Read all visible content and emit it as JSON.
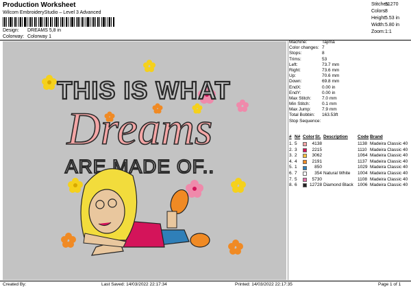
{
  "header": {
    "title": "Production Worksheet",
    "software": "Wilcom EmbroideryStudio – Level 3 Advanced",
    "design_label": "Design:",
    "design_value": "DREAMS 5,8 in",
    "colorway_label": "Colorway:",
    "colorway_value": "Colorway 1"
  },
  "stats": [
    {
      "label": "Stitches:",
      "value": "31270"
    },
    {
      "label": "Colors:",
      "value": "8"
    },
    {
      "label": "Height:",
      "value": "5.53 in"
    },
    {
      "label": "Width:",
      "value": "5.80 in"
    },
    {
      "label": "Zoom:",
      "value": "1:1"
    }
  ],
  "artwork": {
    "line1": "THIS IS WHAT",
    "line2": "Dreams",
    "line3": "ARE MADE OF..",
    "background": "#c3c3c3"
  },
  "machine_info": [
    {
      "label": "Machine:",
      "value": "Tajima"
    },
    {
      "label": "Color changes:",
      "value": "7"
    },
    {
      "label": "Stops:",
      "value": "8"
    },
    {
      "label": "Trims:",
      "value": "53"
    },
    {
      "label": "Left:",
      "value": "73.7 mm"
    },
    {
      "label": "Right:",
      "value": "73.6 mm"
    },
    {
      "label": "Up:",
      "value": "70.6 mm"
    },
    {
      "label": "Down:",
      "value": "69.8 mm"
    },
    {
      "label": "EndX:",
      "value": "0.00 in"
    },
    {
      "label": "EndY:",
      "value": "0.00 in"
    },
    {
      "label": "Max Stitch:",
      "value": "7.0 mm"
    },
    {
      "label": "Min Stitch:",
      "value": "0.1 mm"
    },
    {
      "label": "Max Jump:",
      "value": "7.9 mm"
    },
    {
      "label": "Total Bobbin:",
      "value": "163.53ft"
    }
  ],
  "stop_sequence": {
    "title": "Stop Sequence:",
    "headers": {
      "n": "#",
      "n2": "N#",
      "color": "Color",
      "st": "St.",
      "description": "Description",
      "code": "Code",
      "brand": "Brand"
    },
    "rows": [
      {
        "n": "1.",
        "n2": "5",
        "color": "#f4a6a6",
        "st": "4138",
        "description": "",
        "code": "1138",
        "brand": "Madeira Classic 40"
      },
      {
        "n": "2.",
        "n2": "3",
        "color": "#d4145a",
        "st": "2215",
        "description": "",
        "code": "1110",
        "brand": "Madeira Classic 40"
      },
      {
        "n": "3.",
        "n2": "2",
        "color": "#f5c242",
        "st": "3062",
        "description": "",
        "code": "1064",
        "brand": "Madeira Classic 40"
      },
      {
        "n": "4.",
        "n2": "4",
        "color": "#f08a24",
        "st": "2191",
        "description": "",
        "code": "1137",
        "brand": "Madeira Classic 40"
      },
      {
        "n": "5.",
        "n2": "1",
        "color": "#2f7fb8",
        "st": "850",
        "description": "",
        "code": "1029",
        "brand": "Madeira Classic 40"
      },
      {
        "n": "6.",
        "n2": "7",
        "color": "#ffffff",
        "st": "354",
        "description": "Natural White",
        "code": "1004",
        "brand": "Madeira Classic 40"
      },
      {
        "n": "7.",
        "n2": "5",
        "color": "#e26ea8",
        "st": "5730",
        "description": "",
        "code": "1108",
        "brand": "Madeira Classic 40"
      },
      {
        "n": "8.",
        "n2": "6",
        "color": "#222222",
        "st": "12728",
        "description": "Diamond Black",
        "code": "1006",
        "brand": "Madeira Classic 40"
      }
    ]
  },
  "footer": {
    "created_by": "Created By:",
    "last_saved": "Last Saved: 14/03/2022 22:17:34",
    "printed": "Printed: 14/03/2022 22:17:35",
    "page": "Page 1 of 1"
  }
}
